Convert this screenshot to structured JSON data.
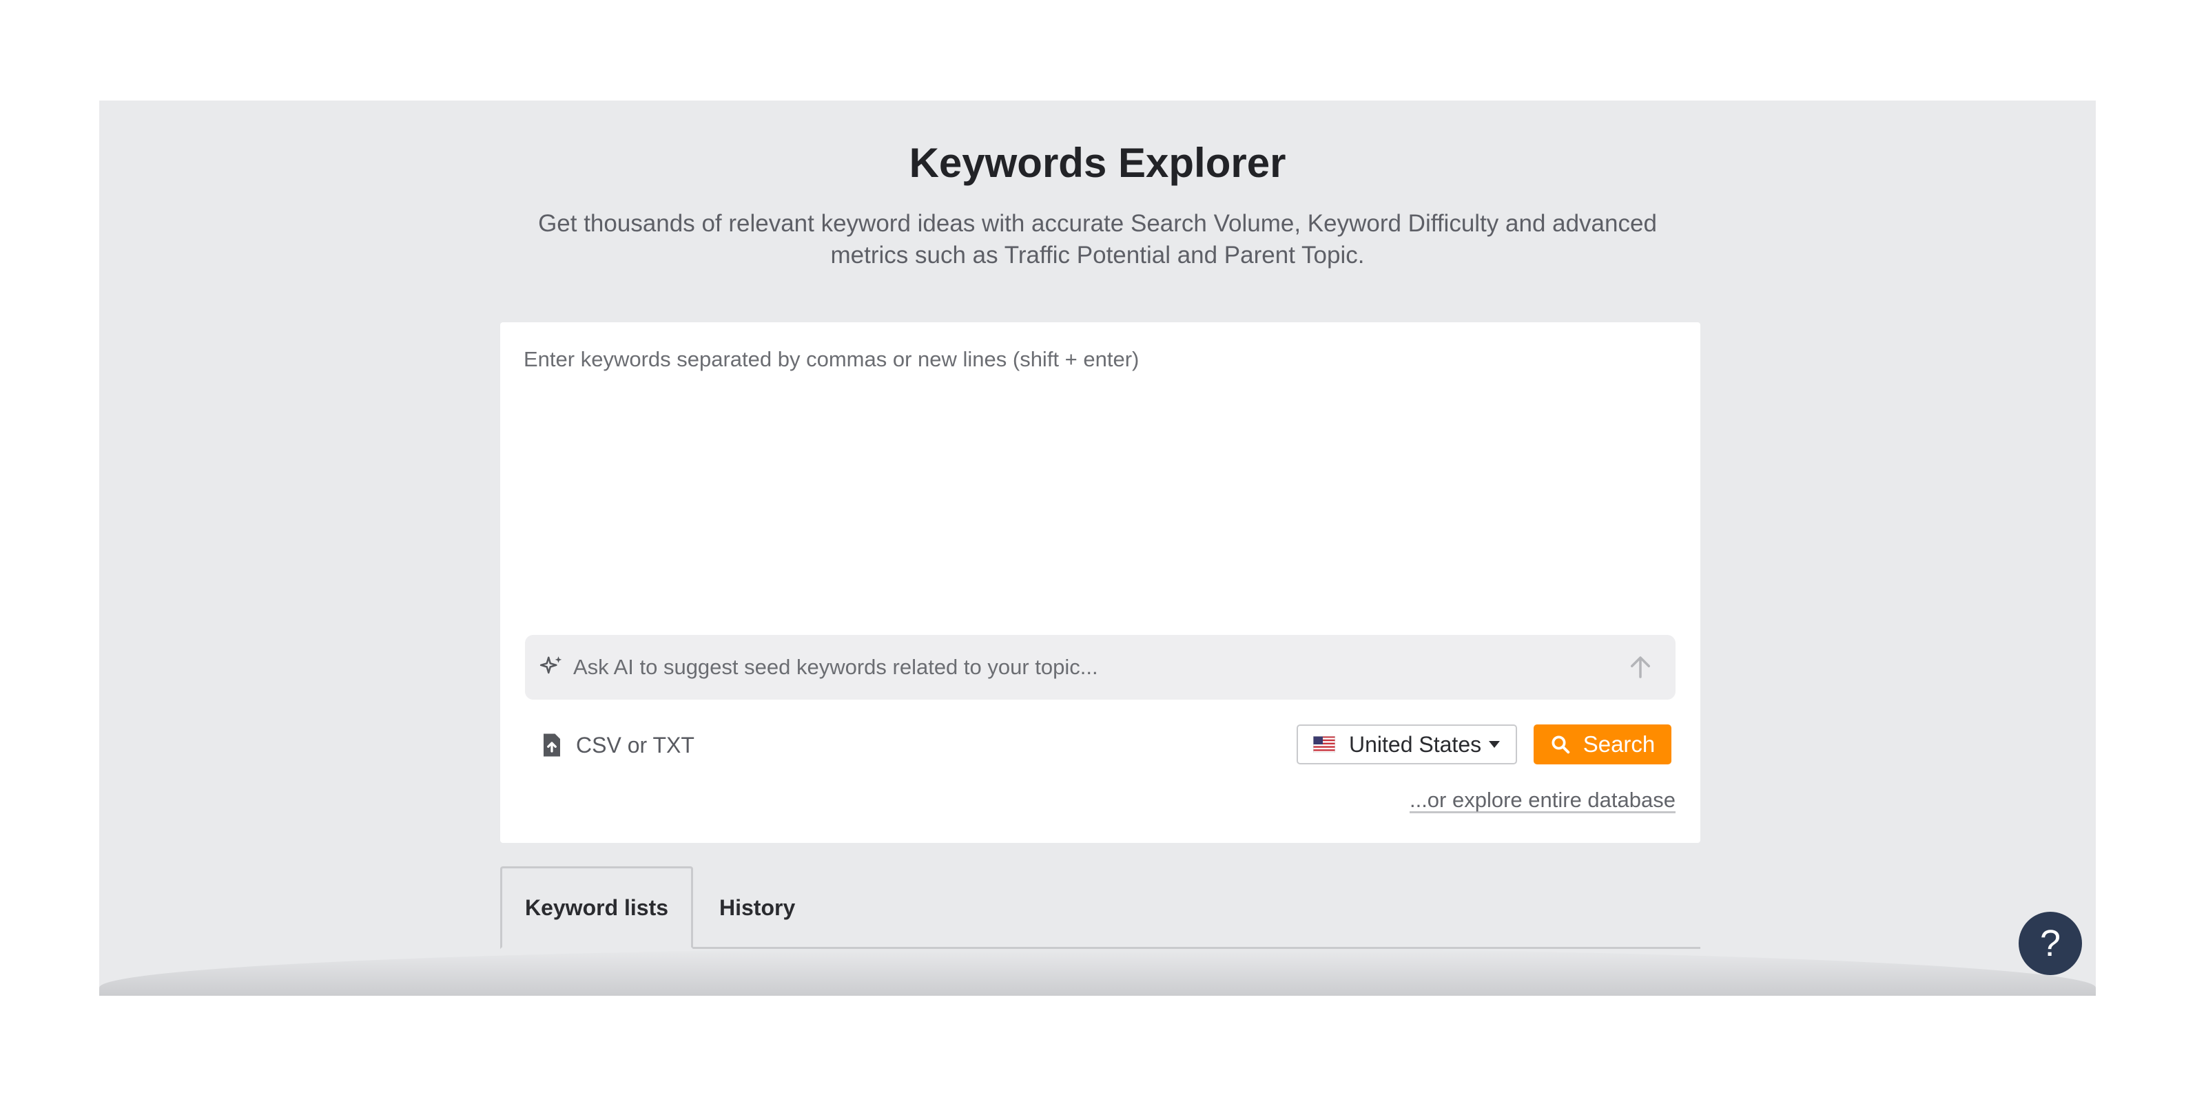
{
  "header": {
    "title": "Keywords Explorer",
    "subtitle": "Get thousands of relevant keyword ideas with accurate Search Volume, Keyword Difficulty and advanced metrics such as Traffic Potential and Parent Topic."
  },
  "form": {
    "keywords_placeholder": "Enter keywords separated by commas or new lines (shift + enter)",
    "ai_placeholder": "Ask AI to suggest seed keywords related to your topic...",
    "upload_label": "CSV or TXT",
    "country": "United States",
    "search_label": "Search",
    "explore_link": "...or explore entire database",
    "accent_color": "#ff8c00"
  },
  "tabs": [
    {
      "label": "Keyword lists",
      "active": true
    },
    {
      "label": "History",
      "active": false
    }
  ],
  "help": {
    "label": "?"
  },
  "icons": {
    "ai": "sparkle-icon",
    "send": "arrow-up-icon",
    "upload": "file-upload-icon",
    "flag": "us-flag-icon",
    "caret": "caret-down-icon",
    "search": "search-icon"
  }
}
